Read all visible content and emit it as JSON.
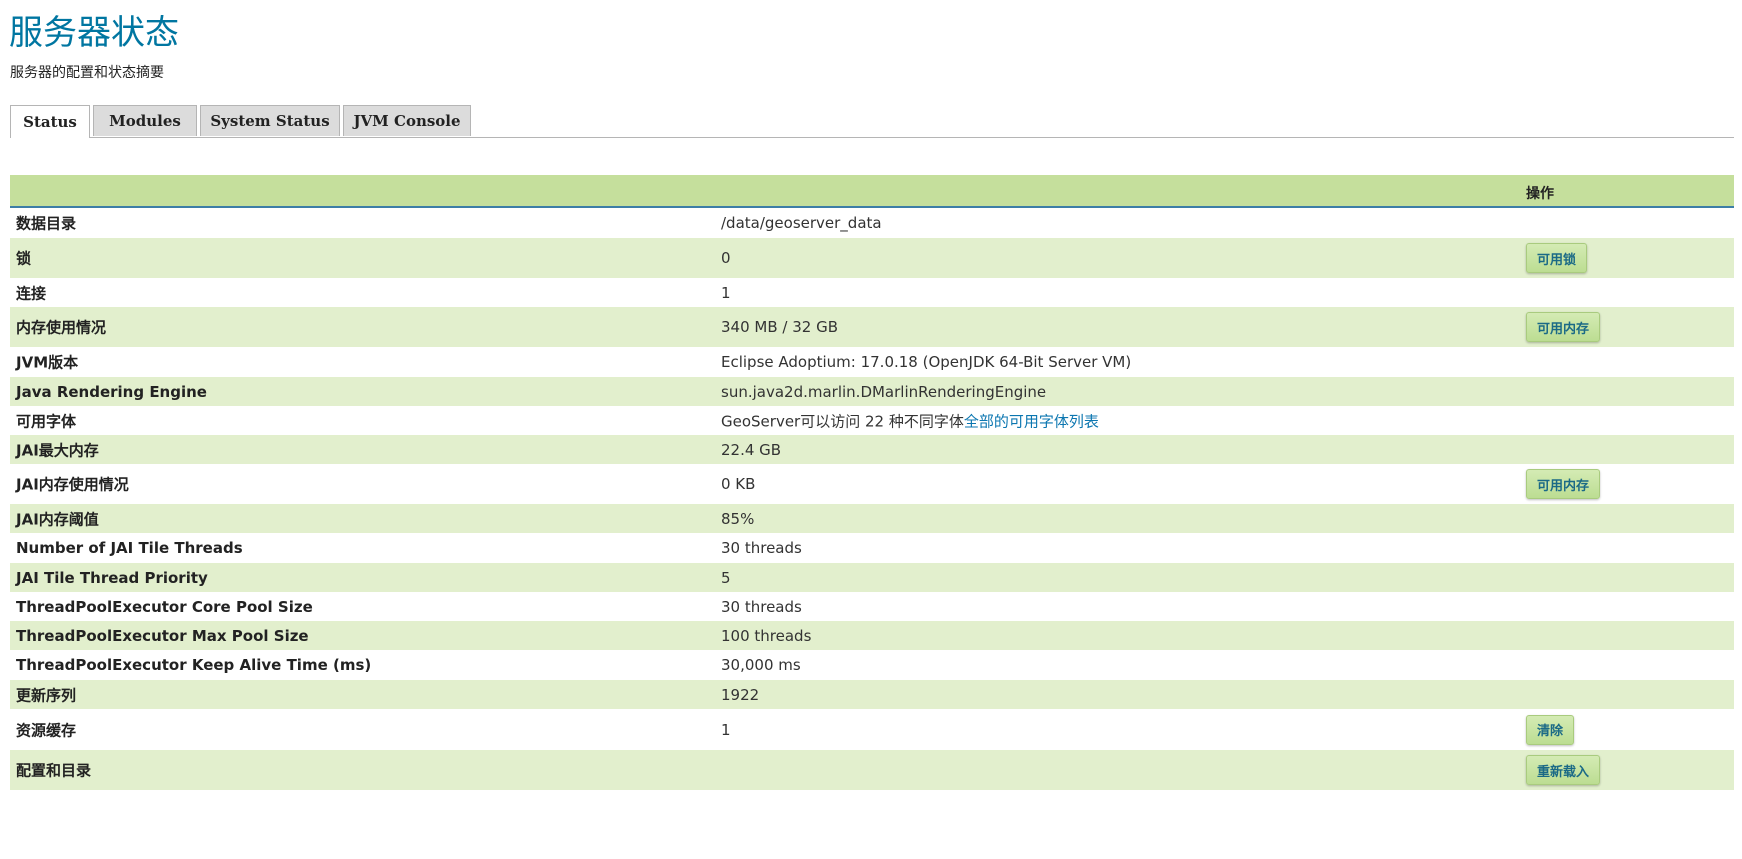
{
  "page": {
    "title": "服务器状态",
    "subtitle": "服务器的配置和状态摘要"
  },
  "tabs": [
    {
      "label": "Status",
      "active": true
    },
    {
      "label": "Modules",
      "active": false
    },
    {
      "label": "System Status",
      "active": false
    },
    {
      "label": "JVM Console",
      "active": false
    }
  ],
  "table": {
    "header_action": "操作",
    "rows": [
      {
        "label": "数据目录",
        "value": "/data/geoserver_data"
      },
      {
        "label": "锁",
        "value": "0",
        "action": "可用锁"
      },
      {
        "label": "连接",
        "value": "1"
      },
      {
        "label": "内存使用情况",
        "value": "340 MB / 32 GB",
        "action": "可用内存"
      },
      {
        "label": "JVM版本",
        "value": "Eclipse Adoptium: 17.0.18 (OpenJDK 64-Bit Server VM)"
      },
      {
        "label": "Java Rendering Engine",
        "value": "sun.java2d.marlin.DMarlinRenderingEngine"
      },
      {
        "label": "可用字体",
        "value": "GeoServer可以访问 22 种不同字体",
        "link": "全部的可用字体列表"
      },
      {
        "label": "JAI最大内存",
        "value": "22.4 GB"
      },
      {
        "label": "JAI内存使用情况",
        "value": "0 KB",
        "action": "可用内存"
      },
      {
        "label": "JAI内存阈值",
        "value": "85%"
      },
      {
        "label": "Number of JAI Tile Threads",
        "value": "30 threads"
      },
      {
        "label": "JAI Tile Thread Priority",
        "value": "5"
      },
      {
        "label": "ThreadPoolExecutor Core Pool Size",
        "value": "30 threads"
      },
      {
        "label": "ThreadPoolExecutor Max Pool Size",
        "value": "100 threads"
      },
      {
        "label": "ThreadPoolExecutor Keep Alive Time (ms)",
        "value": "30,000 ms"
      },
      {
        "label": "更新序列",
        "value": "1922"
      },
      {
        "label": "资源缓存",
        "value": "1",
        "action": "清除"
      },
      {
        "label": "配置和目录",
        "value": "",
        "action": "重新载入"
      }
    ]
  }
}
